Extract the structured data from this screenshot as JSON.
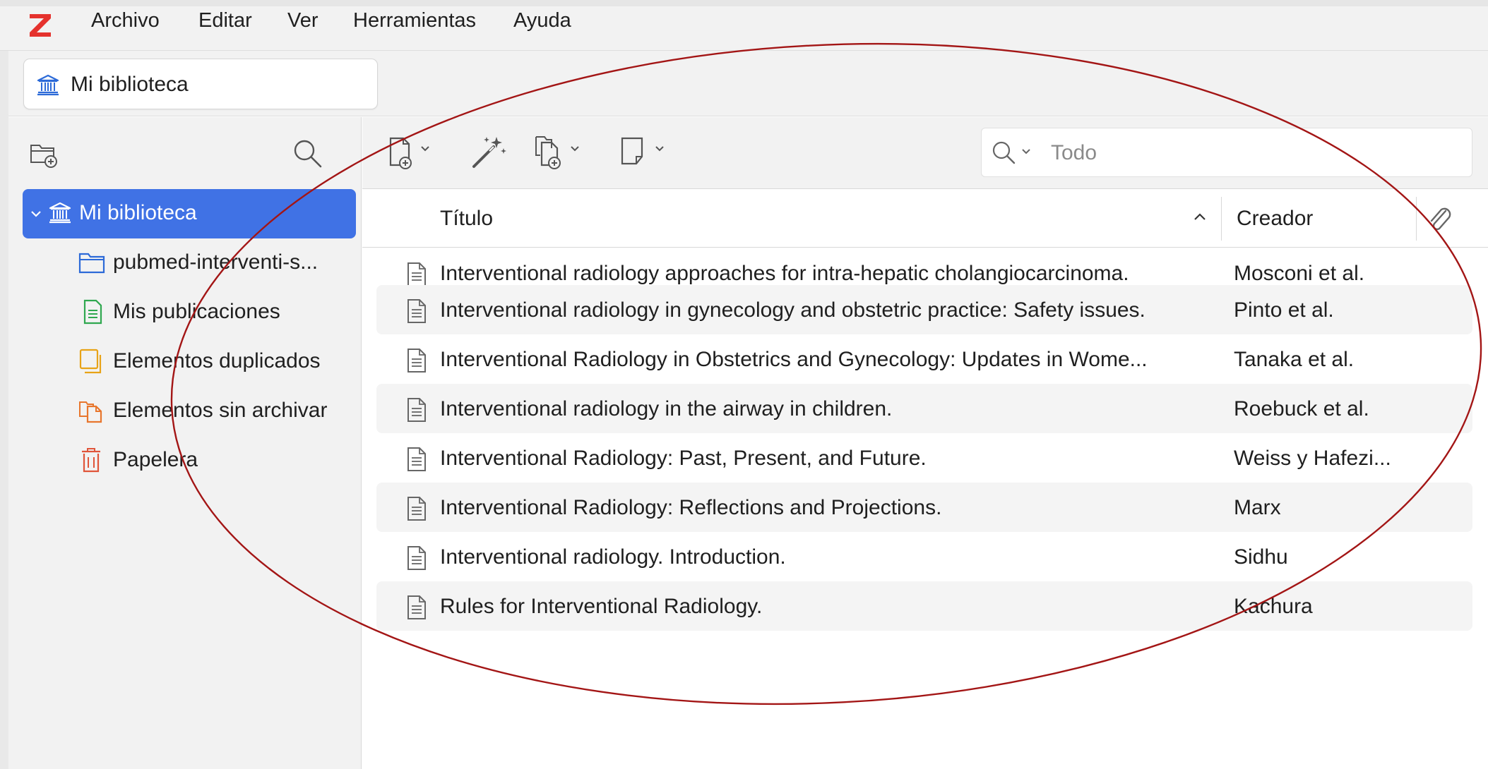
{
  "menubar": {
    "logo_icon": "zotero-z-logo",
    "logo_color": "#e5322d",
    "items": [
      "Archivo",
      "Editar",
      "Ver",
      "Herramientas",
      "Ayuda"
    ]
  },
  "tab": {
    "label": "Mi biblioteca",
    "icon": "library-icon"
  },
  "left_pane": {
    "new_collection_icon": "new-collection-icon",
    "filter_icon": "search-icon",
    "tree": [
      {
        "label": "Mi biblioteca",
        "icon": "library-icon",
        "selected": true,
        "expanded": true
      },
      {
        "label": "pubmed-interventi-s...",
        "icon": "folder-icon"
      },
      {
        "label": "Mis publicaciones",
        "icon": "publications-icon"
      },
      {
        "label": "Elementos duplicados",
        "icon": "duplicates-icon"
      },
      {
        "label": "Elementos sin archivar",
        "icon": "unfiled-icon"
      },
      {
        "label": "Papelera",
        "icon": "trash-icon"
      }
    ]
  },
  "toolbar": {
    "buttons": [
      "new-item-icon",
      "magic-wand-icon",
      "add-attachment-icon",
      "new-note-icon"
    ],
    "search": {
      "placeholder": "Todo",
      "icon": "search-icon"
    }
  },
  "columns": {
    "title": "Título",
    "creator": "Creador",
    "sort": "ascending",
    "attachments_icon": "paperclip-icon"
  },
  "items": [
    {
      "title": "Interventional radiology approaches for intra-hepatic cholangiocarcinoma.",
      "creator": "Mosconi et al."
    },
    {
      "title": "Interventional radiology in gynecology and obstetric practice: Safety issues.",
      "creator": "Pinto et al."
    },
    {
      "title": "Interventional Radiology in Obstetrics and Gynecology: Updates in Wome...",
      "creator": "Tanaka et al."
    },
    {
      "title": "Interventional radiology in the airway in children.",
      "creator": "Roebuck et al."
    },
    {
      "title": "Interventional Radiology: Past, Present, and Future.",
      "creator": "Weiss y Hafezi..."
    },
    {
      "title": "Interventional Radiology: Reflections and Projections.",
      "creator": "Marx"
    },
    {
      "title": "Interventional radiology. Introduction.",
      "creator": "Sidhu"
    },
    {
      "title": "Rules for Interventional Radiology.",
      "creator": "Kachura"
    }
  ],
  "colors": {
    "accent": "#4072e5",
    "annotation": "#a31515"
  }
}
